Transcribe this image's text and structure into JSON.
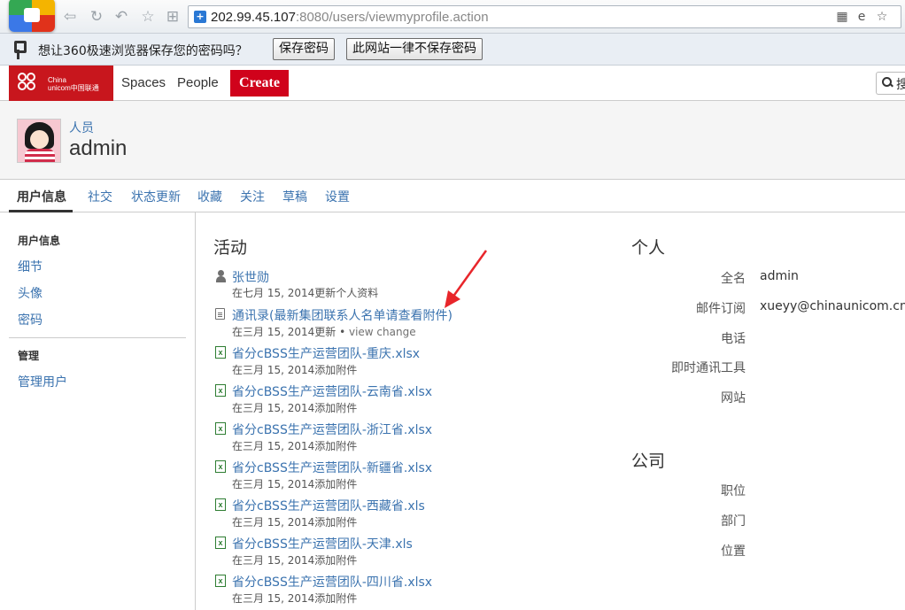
{
  "browser": {
    "url_host": "202.99.45.107",
    "url_rest": ":8080/users/viewmyprofile.action",
    "password_prompt": "想让360极速浏览器保存您的密码吗？",
    "save_password_button": "保存密码",
    "never_save_button": "此网站一律不保存密码"
  },
  "header": {
    "logo_text_line1": "China",
    "logo_text_line2": "unicom中国联通",
    "nav_spaces": "Spaces",
    "nav_people": "People",
    "create_button": "Create",
    "search_partial": "搜",
    "create_color": "#d0021b"
  },
  "profile": {
    "breadcrumb": "人员",
    "name": "admin"
  },
  "tabs": [
    "用户信息",
    "社交",
    "状态更新",
    "收藏",
    "关注",
    "草稿",
    "设置"
  ],
  "sidebar": {
    "section1": "用户信息",
    "items1": [
      "细节",
      "头像",
      "密码"
    ],
    "section2": "管理",
    "items2": [
      "管理用户"
    ]
  },
  "activity": {
    "title": "活动",
    "items": [
      {
        "icon": "user-icon",
        "title": "张世勋",
        "meta": "在七月 15, 2014更新个人资料"
      },
      {
        "icon": "page-icon",
        "title": "通讯录(最新集团联系人名单请查看附件)",
        "meta": "在三月 15, 2014更新",
        "extra": "view change"
      },
      {
        "icon": "excel-icon",
        "title": "省分cBSS生产运营团队-重庆.xlsx",
        "meta": "在三月 15, 2014添加附件"
      },
      {
        "icon": "excel-icon",
        "title": "省分cBSS生产运营团队-云南省.xlsx",
        "meta": "在三月 15, 2014添加附件"
      },
      {
        "icon": "excel-icon",
        "title": "省分cBSS生产运营团队-浙江省.xlsx",
        "meta": "在三月 15, 2014添加附件"
      },
      {
        "icon": "excel-icon",
        "title": "省分cBSS生产运营团队-新疆省.xlsx",
        "meta": "在三月 15, 2014添加附件"
      },
      {
        "icon": "excel-icon",
        "title": "省分cBSS生产运营团队-西藏省.xls",
        "meta": "在三月 15, 2014添加附件"
      },
      {
        "icon": "excel-icon",
        "title": "省分cBSS生产运营团队-天津.xls",
        "meta": "在三月 15, 2014添加附件"
      },
      {
        "icon": "excel-icon",
        "title": "省分cBSS生产运营团队-四川省.xlsx",
        "meta": "在三月 15, 2014添加附件"
      }
    ]
  },
  "personal": {
    "title": "个人",
    "fields": [
      {
        "label": "全名",
        "value": "admin"
      },
      {
        "label": "邮件订阅",
        "value": "xueyy@chinaunicom.cn"
      },
      {
        "label": "电话",
        "value": ""
      },
      {
        "label": "即时通讯工具",
        "value": ""
      },
      {
        "label": "网站",
        "value": ""
      }
    ]
  },
  "company": {
    "title": "公司",
    "fields": [
      {
        "label": "职位",
        "value": ""
      },
      {
        "label": "部门",
        "value": ""
      },
      {
        "label": "位置",
        "value": ""
      }
    ]
  }
}
